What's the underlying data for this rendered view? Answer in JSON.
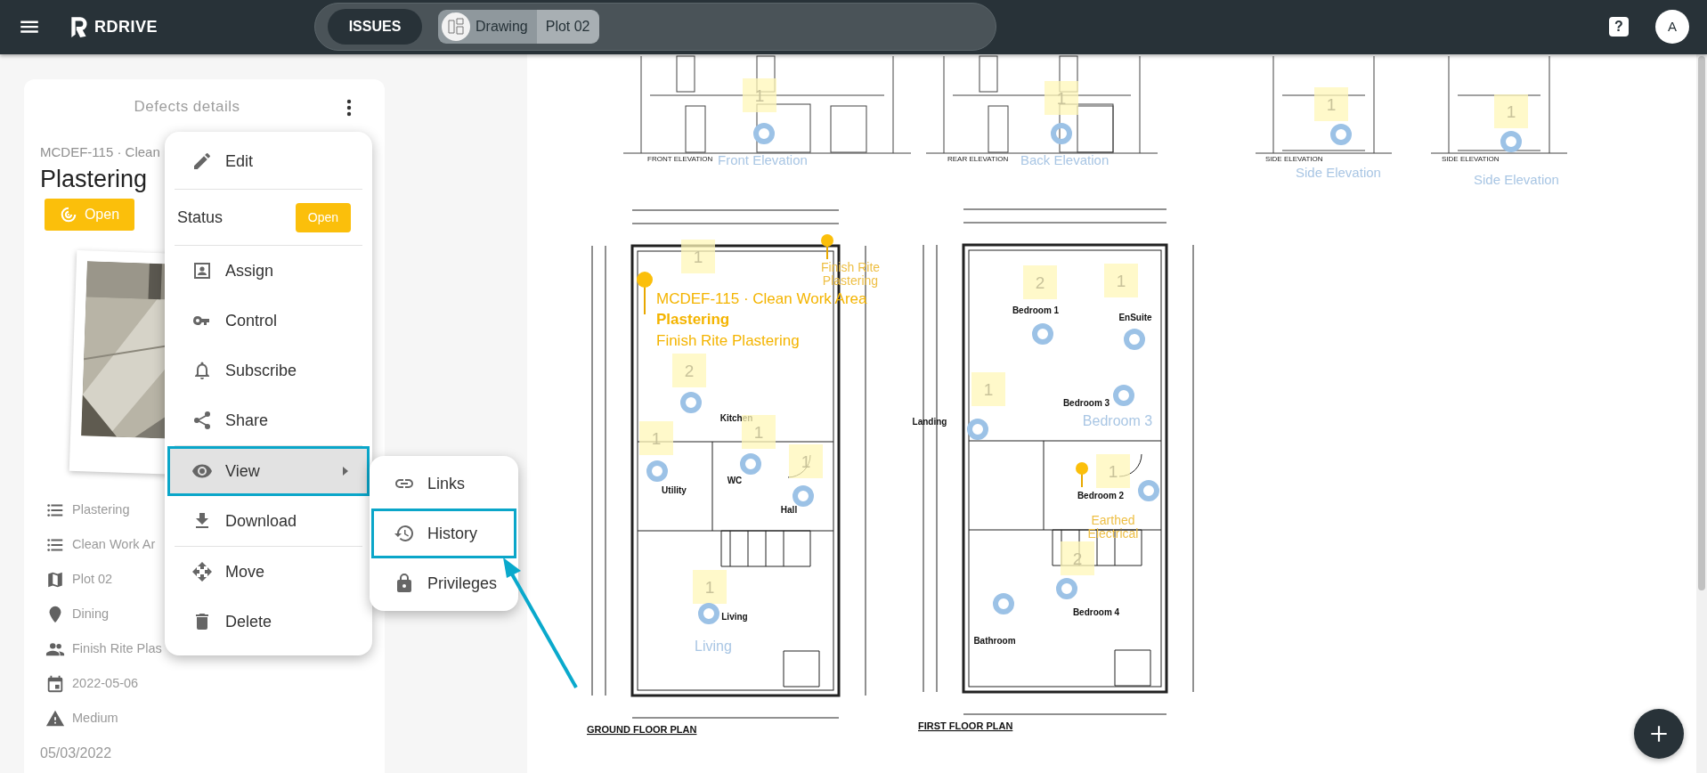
{
  "header": {
    "logo": "RDRIVE",
    "tabs": [
      {
        "label": "ISSUES",
        "selected": true
      }
    ],
    "breadcrumb": [
      {
        "kind": "thumb",
        "label": "Drawing"
      },
      {
        "kind": "plain",
        "label": "Plot 02"
      }
    ],
    "help": "?",
    "avatar": "A"
  },
  "defect": {
    "heading": "Defects details",
    "code": "MCDEF-115 · Clean",
    "title": "Plastering",
    "status": "Open",
    "details": [
      {
        "kind": "list",
        "text": "Plastering"
      },
      {
        "kind": "list",
        "text": "Clean Work Ar"
      },
      {
        "kind": "map",
        "text": "Plot 02"
      },
      {
        "kind": "place",
        "text": "Dining"
      },
      {
        "kind": "people",
        "text": "Finish Rite Plas"
      },
      {
        "kind": "calendar",
        "text": "2022-05-06"
      },
      {
        "kind": "warning",
        "text": "Medium"
      }
    ],
    "created": "05/03/2022"
  },
  "menu": {
    "groups": [
      [
        {
          "kind": "edit",
          "label": "Edit",
          "selected": false
        }
      ],
      [
        {
          "kind": "status",
          "label": "Status",
          "badge": "Open",
          "selected": false
        }
      ],
      [
        {
          "kind": "assign",
          "label": "Assign",
          "selected": false
        },
        {
          "kind": "control",
          "label": "Control",
          "selected": false
        },
        {
          "kind": "subscribe",
          "label": "Subscribe",
          "selected": false
        },
        {
          "kind": "share",
          "label": "Share",
          "selected": false
        }
      ],
      [
        {
          "kind": "view",
          "label": "View",
          "selected": true,
          "submenu": true
        },
        {
          "kind": "download",
          "label": "Download",
          "selected": false
        }
      ],
      [
        {
          "kind": "move",
          "label": "Move",
          "selected": false
        },
        {
          "kind": "delete",
          "label": "Delete",
          "selected": false
        }
      ]
    ]
  },
  "submenu": {
    "items": [
      {
        "kind": "links",
        "label": "Links",
        "selected": false
      },
      {
        "kind": "history",
        "label": "History",
        "selected": true
      },
      {
        "kind": "privileges",
        "label": "Privileges",
        "selected": false
      }
    ]
  },
  "drawing": {
    "elevations": [
      {
        "title": "FRONT ELEVATION",
        "label": "Front Elevation"
      },
      {
        "title": "REAR ELEVATION",
        "label": "Back Elevation"
      },
      {
        "title": "SIDE ELEVATION",
        "label": "Side Elevation"
      },
      {
        "title": "SIDE ELEVATION",
        "label": "Side Elevation"
      }
    ],
    "plans": [
      {
        "title": "GROUND FLOOR PLAN",
        "rooms": [
          "Kitchen",
          "WC",
          "Utility",
          "Hall",
          "Living"
        ]
      },
      {
        "title": "FIRST FLOOR PLAN",
        "rooms": [
          "Bedroom 1",
          "EnSuite",
          "Landing",
          "Bedroom 3",
          "Bedroom 2",
          "Bathroom",
          "Bedroom 4"
        ]
      }
    ],
    "area_labels": [
      "Living",
      "Bedroom 3"
    ],
    "faint_labels": [
      [
        "Finish Rite",
        "Plastering"
      ],
      [
        "Earthed",
        "Electrical"
      ]
    ],
    "notes": [
      "1",
      "1",
      "1",
      "1",
      "1",
      "2",
      "1",
      "1",
      "2",
      "1",
      "1",
      "1",
      "2",
      "1",
      "1"
    ],
    "selected_defect": {
      "code": "MCDEF-115 · Clean Work Area",
      "title": "Plastering",
      "contractor": "Finish Rite Plastering"
    }
  }
}
